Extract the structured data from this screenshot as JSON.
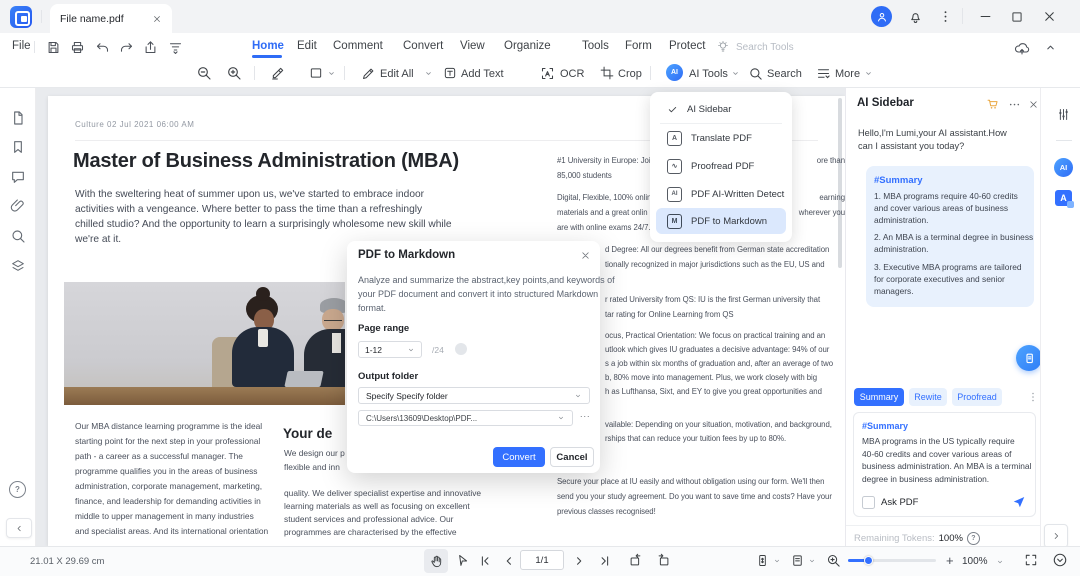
{
  "app": {
    "tab_title": "File name.pdf"
  },
  "menubar": {
    "file": "File",
    "items": [
      "Home",
      "Edit",
      "Comment",
      "Convert",
      "View",
      "Organize",
      "Tools",
      "Form",
      "Protect"
    ],
    "search_placeholder": "Search Tools"
  },
  "toolbar": {
    "edit_all": "Edit All",
    "add_text": "Add Text",
    "ocr": "OCR",
    "crop": "Crop",
    "ai_tools": "AI Tools",
    "search": "Search",
    "more": "More"
  },
  "ai_menu": {
    "i0": "AI Sidebar",
    "i1": "Translate PDF",
    "i2": "Proofread PDF",
    "i3": "PDF AI-Written Detect",
    "i4": "PDF to Markdown"
  },
  "modal": {
    "title": "PDF to Markdown",
    "desc1": "Analyze and summarize the abstract,key points,and keywords of",
    "desc2": "your PDF document and convert it into structured Markdown",
    "desc3": "format.",
    "page_range_label": "Page range",
    "range_value": "1-12",
    "range_total": "/24",
    "output_folder_label": "Output folder",
    "folder_mode": "Specify Specify folder",
    "folder_path": "C:\\Users\\13609\\Desktop\\PDF...",
    "more": "...",
    "convert": "Convert",
    "cancel": "Cancel"
  },
  "doc": {
    "meta": "Culture 02 Jul 2021 06:00 AM",
    "title": "Master of Business Administration (MBA)",
    "intro": [
      "With the sweltering heat of summer upon us, we've started to embrace indoor",
      "activities with a vengeance. Where better to pass the time than a refreshingly",
      "chilled studio? And the opportunity to learn a surprisingly wholesome new skill while",
      "we're at it."
    ],
    "left": [
      "Our MBA distance learning programme is the ideal",
      "starting point for the next step in your professional",
      "path - a career as a successful manager. The",
      "programme qualifies you in the areas of business",
      "administration, corporate management, marketing,",
      "finance, and leadership for demanding activities in",
      "middle to upper management in many industries",
      "and specialist areas. And its international orientation"
    ],
    "mid_heading": "Your de",
    "mid": [
      "We design our p",
      "flexible and inn",
      "quality. We deliver specialist expertise and innovative",
      "learning materials as well as focusing on excellent",
      "student services and professional advice. Our",
      "programmes are characterised by the effective"
    ],
    "right": {
      "p1": [
        {
          "l": "#1 University in Europe: Joi",
          "r": "ore than"
        },
        {
          "l": "85,000 students",
          "r": ""
        }
      ],
      "p2": [
        {
          "l": "Digital, Flexible, 100% onlin",
          "r": "earning"
        },
        {
          "l": "materials and a great onlin",
          "r": "wherever you"
        },
        {
          "l": "are with online exams 24/7.",
          "r": ""
        }
      ],
      "p3": [
        {
          "l": "d Degree: All our degrees benefit from German state accreditation",
          "r": ""
        },
        {
          "l": "tionally recognized in major jurisdictions such as the EU, US and",
          "r": ""
        }
      ],
      "p4": [
        {
          "l": "r rated University from QS: IU is the first German university that",
          "r": ""
        },
        {
          "l": "tar rating for Online Learning from QS",
          "r": ""
        }
      ],
      "p5": [
        {
          "l": "ocus, Practical Orientation: We focus on practical training and an",
          "r": ""
        },
        {
          "l": "utlook which gives IU graduates a decisive advantage: 94% of our",
          "r": ""
        },
        {
          "l": "s a job within six months of graduation and, after an average of two",
          "r": ""
        },
        {
          "l": "b, 80% move into management. Plus, we work closely with big",
          "r": ""
        },
        {
          "l": "h as Lufthansa, Sixt, and EY to give you great opportunities and",
          "r": ""
        }
      ],
      "p6": [
        {
          "l": "vailable: Depending on your situation, motivation, and background,",
          "r": ""
        },
        {
          "l": "rships that can reduce your tuition fees by up to 80%.",
          "r": ""
        }
      ],
      "p7": [
        {
          "l": "Secure your place at IU easily and without obligation using our form. We'll then",
          "r": ""
        },
        {
          "l": "send you your study agreement. Do you want to save time and costs? Have your",
          "r": ""
        },
        {
          "l": "previous classes recognised!",
          "r": ""
        }
      ]
    }
  },
  "ai": {
    "title": "AI Sidebar",
    "greeting1": "Hello,I'm Lumi,your AI assistant.How",
    "greeting2": "can I assistant you today?",
    "bubble_tag": "#Summary",
    "b1": [
      "1. MBA programs require 40-60 credits",
      "and cover various areas of business",
      "administration."
    ],
    "b2": [
      "2. An MBA is a terminal degree in business",
      "administration."
    ],
    "b3": [
      "3. Executive MBA programs are tailored",
      "for corporate executives and senior",
      "managers."
    ],
    "tab_summary": "Summary",
    "tab_rewrite": "Rewite",
    "tab_proofread": "Proofread",
    "card_tag": "#Summary",
    "card": [
      "MBA programs in the US typically require",
      "40-60 credits and cover various areas of",
      "business administration. An MBA is a terminal",
      "degree in business administration."
    ],
    "ask_pdf": "Ask PDF",
    "tokens_label": "Remaining Tokens:",
    "tokens_value": "100%"
  },
  "statusbar": {
    "size": "21.01 X 29.69 cm",
    "page": "1/1",
    "zoom": "100%"
  },
  "colors": {
    "accent": "#3370ff",
    "highlight_row": "#dbe8fd",
    "bubble": "#e8f1fd"
  }
}
